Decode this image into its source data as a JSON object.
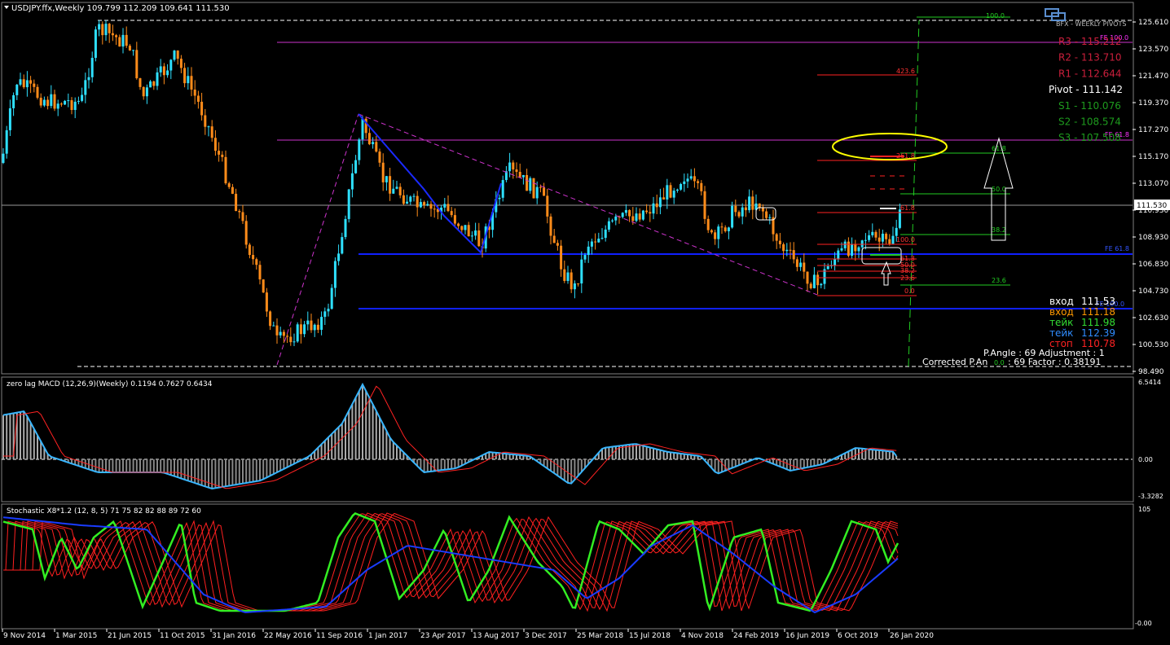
{
  "main": {
    "title": "USDJPY.ffx,Weekly  109.799 112.209 109.641 111.530",
    "price_labels": [
      "125.610",
      "123.570",
      "121.470",
      "119.370",
      "117.270",
      "115.170",
      "113.070",
      "110.930",
      "108.930",
      "106.830",
      "104.730",
      "102.630",
      "100.530",
      "98.490"
    ],
    "current_price": "111.530",
    "pivot_title": "BFX - WEEKLY PIVOTS",
    "pivots": [
      {
        "label": "R3 - 115.212",
        "color": "#cc1f3c"
      },
      {
        "label": "R2 - 113.710",
        "color": "#cc1f3c"
      },
      {
        "label": "R1 - 112.644",
        "color": "#cc1f3c"
      },
      {
        "label": "Pivot - 111.142",
        "color": "#ffffff"
      },
      {
        "label": "S1 - 110.076",
        "color": "#1e9b1e"
      },
      {
        "label": "S2 - 108.574",
        "color": "#1e9b1e"
      },
      {
        "label": "S3 - 107.508",
        "color": "#1e9b1e"
      }
    ],
    "trade": [
      {
        "label": "вход",
        "value": "111.53",
        "color": "#ffffff"
      },
      {
        "label": "вход",
        "value": "111.18",
        "color": "#ff9900"
      },
      {
        "label": "тейк",
        "value": "111.98",
        "color": "#33dd33"
      },
      {
        "label": "тейк",
        "value": "112.39",
        "color": "#2f8cff"
      },
      {
        "label": "стоп",
        "value": "110.78",
        "color": "#ff2222"
      }
    ],
    "angle_line1": "P.Angle : 69   Adjustment : 1",
    "angle_line2": "Corrected P.An",
    "angle_line2b": "0.0",
    "angle_line2c": ": 69   Factor : 0.38191",
    "fib_labels": {
      "f100_top": "100.0",
      "fe100": "FE 100.0",
      "f4236": "423.6",
      "fe618_up": "FE 61.8",
      "f2618": "261.8",
      "f618r": "61.8",
      "f500": "50.0",
      "f382": "38.2",
      "f236": "23.6",
      "f618w": "61.8",
      "f100w": "100.0",
      "fe618": "FE 61.8",
      "f618b": "61.8",
      "f500b": "50.0",
      "f382b": "38.2",
      "f236b": "23.6",
      "f00": "0.0",
      "fe1000": "FE 100.0"
    },
    "colors": {
      "bull": "#2ee0ff",
      "bear": "#ff8c1a",
      "magenta": "#ff00ff",
      "blue": "#1020ff",
      "yellow": "#ffff00"
    }
  },
  "macd": {
    "title": "zero lag MACD (12,26,9)(Weekly) 0.1194 0.7627 0.6434",
    "labels": [
      "6.5414",
      "0.00",
      "-3.3282"
    ]
  },
  "stoch": {
    "title": "Stochastic X8*1.2 (12, 8, 5) 71 75 82 82 88 89 72 60",
    "labels": [
      "105",
      "-0.00"
    ]
  },
  "xaxis": [
    "9 Nov 2014",
    "1 Mar 2015",
    "21 Jun 2015",
    "11 Oct 2015",
    "31 Jan 2016",
    "22 May 2016",
    "11 Sep 2016",
    "1 Jan 2017",
    "23 Apr 2017",
    "13 Aug 2017",
    "3 Dec 2017",
    "25 Mar 2018",
    "15 Jul 2018",
    "4 Nov 2018",
    "24 Feb 2019",
    "16 Jun 2019",
    "6 Oct 2019",
    "26 Jan 2020"
  ]
}
